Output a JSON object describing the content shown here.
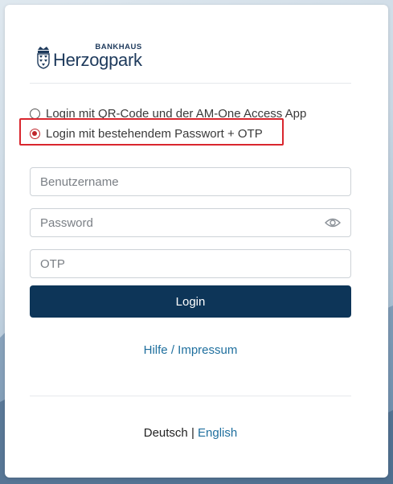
{
  "logo": {
    "small_text": "BANKHAUS",
    "big_text": "Herzogpark",
    "crest_icon": "bavarian-crest-icon"
  },
  "login_options": [
    {
      "label": "Login mit QR-Code und der AM-One Access App",
      "selected": false
    },
    {
      "label": "Login mit bestehendem Passwort + OTP",
      "selected": true
    }
  ],
  "form": {
    "username_placeholder": "Benutzername",
    "password_placeholder": "Password",
    "otp_placeholder": "OTP",
    "password_toggle_icon": "eye-icon",
    "login_label": "Login"
  },
  "help": {
    "label": "Hilfe / Impressum"
  },
  "language": {
    "current": "Deutsch",
    "separator": "|",
    "other": "English"
  },
  "colors": {
    "primary_button": "#0d3558",
    "link": "#1f6f9e",
    "highlight_border": "#d9262e",
    "brand": "#1e3a5c"
  }
}
